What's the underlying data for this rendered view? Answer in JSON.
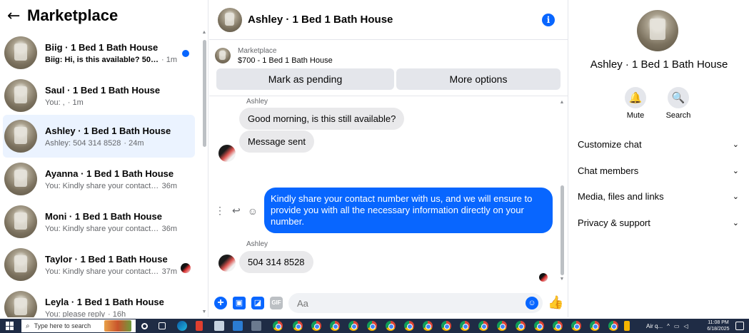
{
  "left": {
    "back_icon": "←",
    "title": "Marketplace",
    "conversations": [
      {
        "name": "Biig · 1 Bed 1 Bath House",
        "preview": "Biig: Hi, is this available? 50431...",
        "time": "· 1m",
        "unread": true
      },
      {
        "name": "Saul · 1 Bed 1 Bath House",
        "preview": "You: , ",
        "time": "· 1m",
        "unread": false
      },
      {
        "name": "Ashley · 1 Bed 1 Bath House",
        "preview": "Ashley: 504 314 8528 ",
        "time": "· 24m",
        "unread": false,
        "active": true
      },
      {
        "name": "Ayanna · 1 Bed 1 Bath House",
        "preview": "You: Kindly share your contact nu...",
        "time": "36m",
        "unread": false
      },
      {
        "name": "Moni · 1 Bed 1 Bath House",
        "preview": "You: Kindly share your contact nu...",
        "time": "36m",
        "unread": false
      },
      {
        "name": "Taylor · 1 Bed 1 Bath House",
        "preview": "You: Kindly share your contact ...",
        "time": "37m",
        "unread": false
      },
      {
        "name": "Leyla · 1 Bed 1 Bath House",
        "preview": "You: please reply ",
        "time": "· 16h",
        "unread": false
      }
    ]
  },
  "chat": {
    "title": "Ashley · 1 Bed 1 Bath House",
    "info_icon": "i",
    "marketplace_label": "Marketplace",
    "listing": "$700 - 1 Bed 1 Bath House",
    "mark_pending_label": "Mark as pending",
    "more_options_label": "More options",
    "messages": {
      "sender_1": "Ashley",
      "msg_1": "Good morning, is this still available?",
      "msg_2": "Message sent",
      "msg_out": "Kindly share your contact number with us, and we will ensure to provide you with all the necessary information directly on your number.",
      "sender_2": "Ashley",
      "msg_3": "504 314 8528"
    },
    "actions": {
      "more": "⋮",
      "reply": "↩",
      "react": "☺"
    },
    "composer": {
      "placeholder": "Aa",
      "plus_icon": "+",
      "photo_icon": "▣",
      "sticker_icon": "◪",
      "gif_icon": "GIF",
      "emoji_icon": "☺",
      "like_icon": "👍"
    }
  },
  "details": {
    "title": "Ashley · 1 Bed 1 Bath House",
    "mute_icon": "🔔",
    "mute_label": "Mute",
    "search_icon": "🔍",
    "search_label": "Search",
    "sections": [
      "Customize chat",
      "Chat members",
      "Media, files and links",
      "Privacy & support"
    ],
    "chevron": "⌄"
  },
  "taskbar": {
    "search_placeholder": "Type here to search",
    "weather": "Air q...",
    "time": "11:08 PM",
    "date": "6/18/2025"
  },
  "colors": {
    "accent": "#0866ff",
    "active_row": "#ebf3ff",
    "incoming_bubble": "#e9e9eb",
    "taskbar": "#1f2c45"
  }
}
